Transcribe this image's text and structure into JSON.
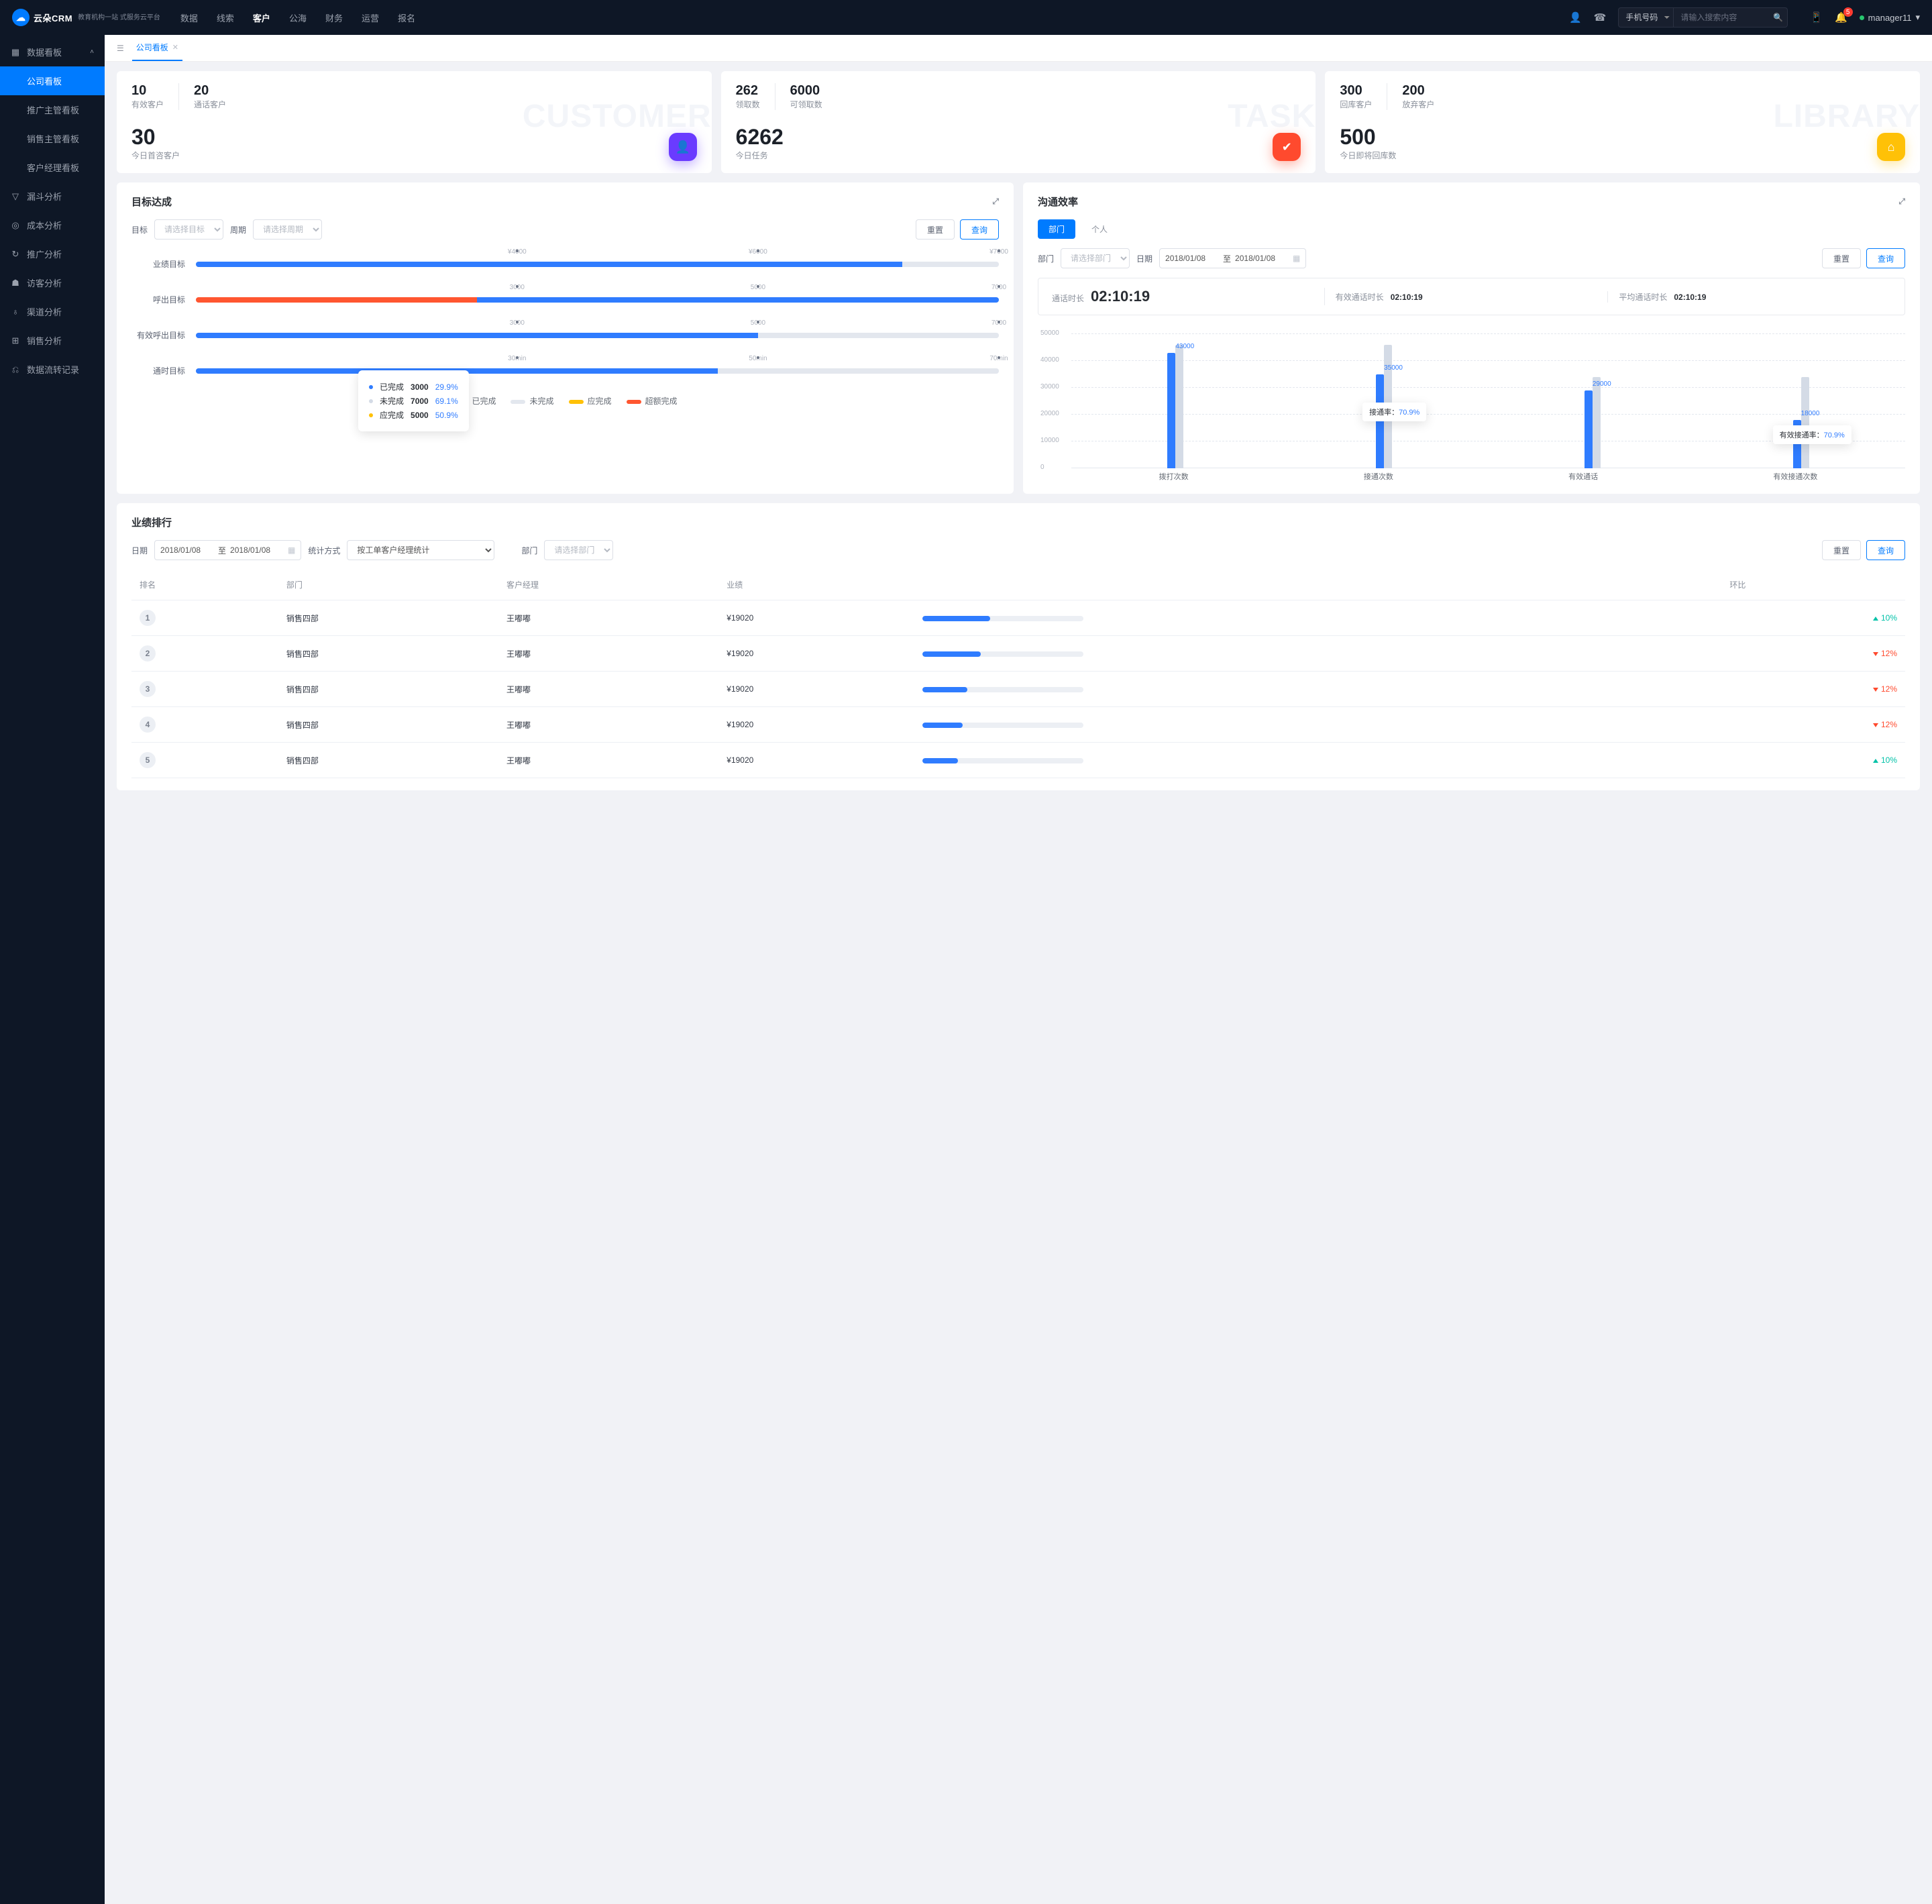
{
  "header": {
    "logo_main": "云朵CRM",
    "logo_sub": "教育机构一站\n式服务云平台",
    "menu": [
      "数据",
      "线索",
      "客户",
      "公海",
      "财务",
      "运营",
      "报名"
    ],
    "active_menu": 2,
    "search_mode": "手机号码",
    "search_placeholder": "请输入搜索内容",
    "badge_count": "5",
    "username": "manager11"
  },
  "sidebar": {
    "group": "数据看板",
    "items": [
      "公司看板",
      "推广主管看板",
      "销售主管看板",
      "客户经理看板"
    ],
    "active_item": 0,
    "nav": [
      "漏斗分析",
      "成本分析",
      "推广分析",
      "访客分析",
      "渠道分析",
      "销售分析",
      "数据流转记录"
    ]
  },
  "tab": {
    "label": "公司看板"
  },
  "summary": [
    {
      "ghost": "CUSTOMER",
      "pairs": [
        {
          "v": "10",
          "l": "有效客户"
        },
        {
          "v": "20",
          "l": "通话客户"
        }
      ],
      "big": {
        "v": "30",
        "l": "今日首咨客户"
      },
      "icon": "person",
      "cls": "ico-purple"
    },
    {
      "ghost": "TASK",
      "pairs": [
        {
          "v": "262",
          "l": "领取数"
        },
        {
          "v": "6000",
          "l": "可领取数"
        }
      ],
      "big": {
        "v": "6262",
        "l": "今日任务"
      },
      "icon": "check",
      "cls": "ico-red"
    },
    {
      "ghost": "LIBRARY",
      "pairs": [
        {
          "v": "300",
          "l": "回库客户"
        },
        {
          "v": "200",
          "l": "放弃客户"
        }
      ],
      "big": {
        "v": "500",
        "l": "今日即将回库数"
      },
      "icon": "home",
      "cls": "ico-yellow"
    }
  ],
  "targets": {
    "title": "目标达成",
    "filter_label_target": "目标",
    "target_placeholder": "请选择目标",
    "filter_label_period": "周期",
    "period_placeholder": "请选择周期",
    "btn_reset": "重置",
    "btn_query": "查询",
    "legend": {
      "done": "已完成",
      "undone": "未完成",
      "should": "应完成",
      "over": "超额完成"
    },
    "tooltip": {
      "done_label": "已完成",
      "done_val": "3000",
      "done_pct": "29.9%",
      "undone_label": "未完成",
      "undone_val": "7000",
      "undone_pct": "69.1%",
      "should_label": "应完成",
      "should_val": "5000",
      "should_pct": "50.9%"
    }
  },
  "chart_data": [
    {
      "type": "bar",
      "title": "目标达成",
      "series_names": [
        "已完成",
        "未完成",
        "应完成",
        "超额完成"
      ],
      "rows": [
        {
          "name": "业绩目标",
          "ticks": [
            "¥4000",
            "¥6000",
            "¥7000"
          ],
          "done_pct": 88,
          "over_pct": 0
        },
        {
          "name": "呼出目标",
          "ticks": [
            "3000",
            "5000",
            "7000"
          ],
          "done_pct": 100,
          "over_pct": 35
        },
        {
          "name": "有效呼出目标",
          "ticks": [
            "3000",
            "5000",
            "7000"
          ],
          "done_pct": 70,
          "over_pct": 0
        },
        {
          "name": "通时目标",
          "ticks": [
            "30min",
            "50min",
            "70min"
          ],
          "done_pct": 65,
          "over_pct": 0
        }
      ]
    },
    {
      "type": "bar",
      "title": "沟通效率",
      "yticks": [
        0,
        10000,
        20000,
        30000,
        40000,
        50000
      ],
      "ylim": [
        0,
        50000
      ],
      "categories": [
        "拨打次数",
        "接通次数",
        "有效通话",
        "有效接通次数"
      ],
      "values": [
        43000,
        35000,
        29000,
        18000
      ],
      "stub_values": [
        46000,
        46000,
        34000,
        34000
      ],
      "annotations": [
        {
          "for": "接通次数",
          "label": "接通率：",
          "value": "70.9%"
        },
        {
          "for": "有效接通次数",
          "label": "有效接通率：",
          "value": "70.9%"
        }
      ]
    }
  ],
  "comm": {
    "title": "沟通效率",
    "tab_dept": "部门",
    "tab_person": "个人",
    "dept_label": "部门",
    "dept_placeholder": "请选择部门",
    "date_label": "日期",
    "date_from": "2018/01/08",
    "date_sep": "至",
    "date_to": "2018/01/08",
    "btn_reset": "重置",
    "btn_query": "查询",
    "band": [
      {
        "label": "通话时长",
        "value": "02:10:19",
        "big": true
      },
      {
        "label": "有效通话时长",
        "value": "02:10:19"
      },
      {
        "label": "平均通话时长",
        "value": "02:10:19"
      }
    ]
  },
  "ranking": {
    "title": "业绩排行",
    "date_label": "日期",
    "date_from": "2018/01/08",
    "date_sep": "至",
    "date_to": "2018/01/08",
    "method_label": "统计方式",
    "method_value": "按工单客户经理统计",
    "dept_label": "部门",
    "dept_placeholder": "请选择部门",
    "btn_reset": "重置",
    "btn_query": "查询",
    "cols": [
      "排名",
      "部门",
      "客户经理",
      "业绩",
      "",
      "环比"
    ],
    "rows": [
      {
        "rank": "1",
        "dept": "销售四部",
        "mgr": "王嘟嘟",
        "amount": "¥19020",
        "bar": 42,
        "delta": "10%",
        "dir": "up"
      },
      {
        "rank": "2",
        "dept": "销售四部",
        "mgr": "王嘟嘟",
        "amount": "¥19020",
        "bar": 36,
        "delta": "12%",
        "dir": "down"
      },
      {
        "rank": "3",
        "dept": "销售四部",
        "mgr": "王嘟嘟",
        "amount": "¥19020",
        "bar": 28,
        "delta": "12%",
        "dir": "down"
      },
      {
        "rank": "4",
        "dept": "销售四部",
        "mgr": "王嘟嘟",
        "amount": "¥19020",
        "bar": 25,
        "delta": "12%",
        "dir": "down"
      },
      {
        "rank": "5",
        "dept": "销售四部",
        "mgr": "王嘟嘟",
        "amount": "¥19020",
        "bar": 22,
        "delta": "10%",
        "dir": "up"
      }
    ]
  }
}
